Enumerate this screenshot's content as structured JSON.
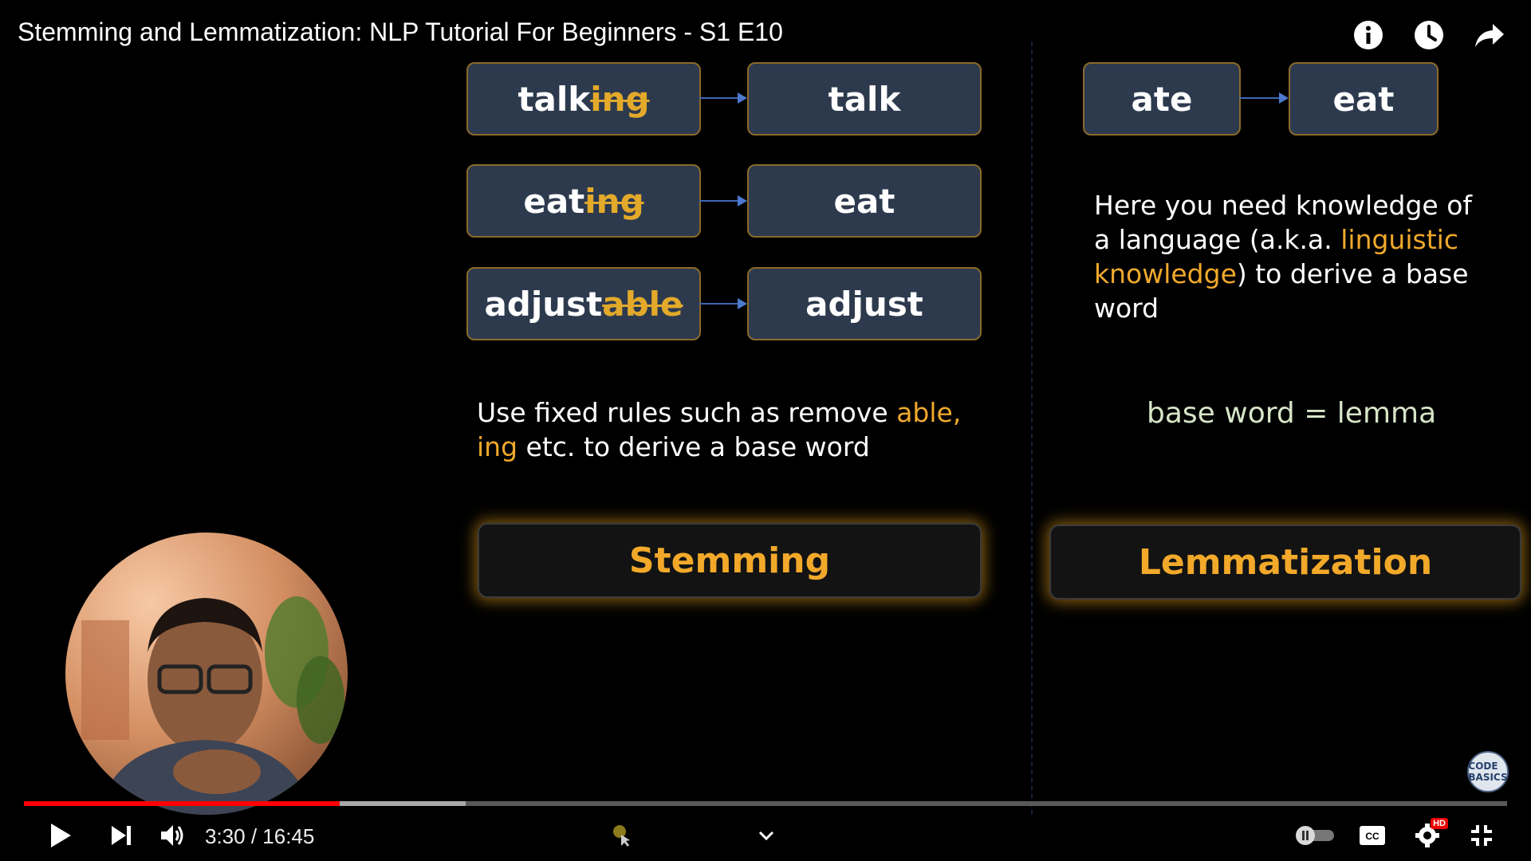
{
  "video": {
    "title": "Stemming and Lemmatization: NLP Tutorial For Beginners - S1 E10",
    "progress_fraction": 0.2128,
    "buffered_fraction": 0.298
  },
  "top_icons": [
    "info-icon",
    "watch-later-clock-icon",
    "share-arrow-icon"
  ],
  "slide": {
    "stemming_examples": [
      {
        "stem": "talk",
        "suffix": "ing",
        "result": "talk"
      },
      {
        "stem": "eat",
        "suffix": "ing",
        "result": "eat"
      },
      {
        "stem": "adjust",
        "suffix": "able",
        "result": "adjust"
      }
    ],
    "lemma_example": {
      "word": "ate",
      "result": "eat"
    },
    "stemming_desc": {
      "part1": "Use fixed rules such as remove ",
      "highlight": "able, ing",
      "part2": " etc. to derive a base word"
    },
    "lemma_desc": {
      "part1": "Here you need knowledge of a language (a.k.a. ",
      "highlight": "linguistic knowledge",
      "part2": ") to derive a base word"
    },
    "lemma_equation": "base word = lemma",
    "stemming_label": "Stemming",
    "lemmatization_label": "Lemmatization"
  },
  "channel_badge": "CODE BASICS",
  "controls": {
    "time": "3:30 / 16:45",
    "hd_label": "HD"
  },
  "colors": {
    "highlight": "#f0a92c",
    "progress_played": "#ff0000",
    "box_fill": "#2d3a4e"
  }
}
